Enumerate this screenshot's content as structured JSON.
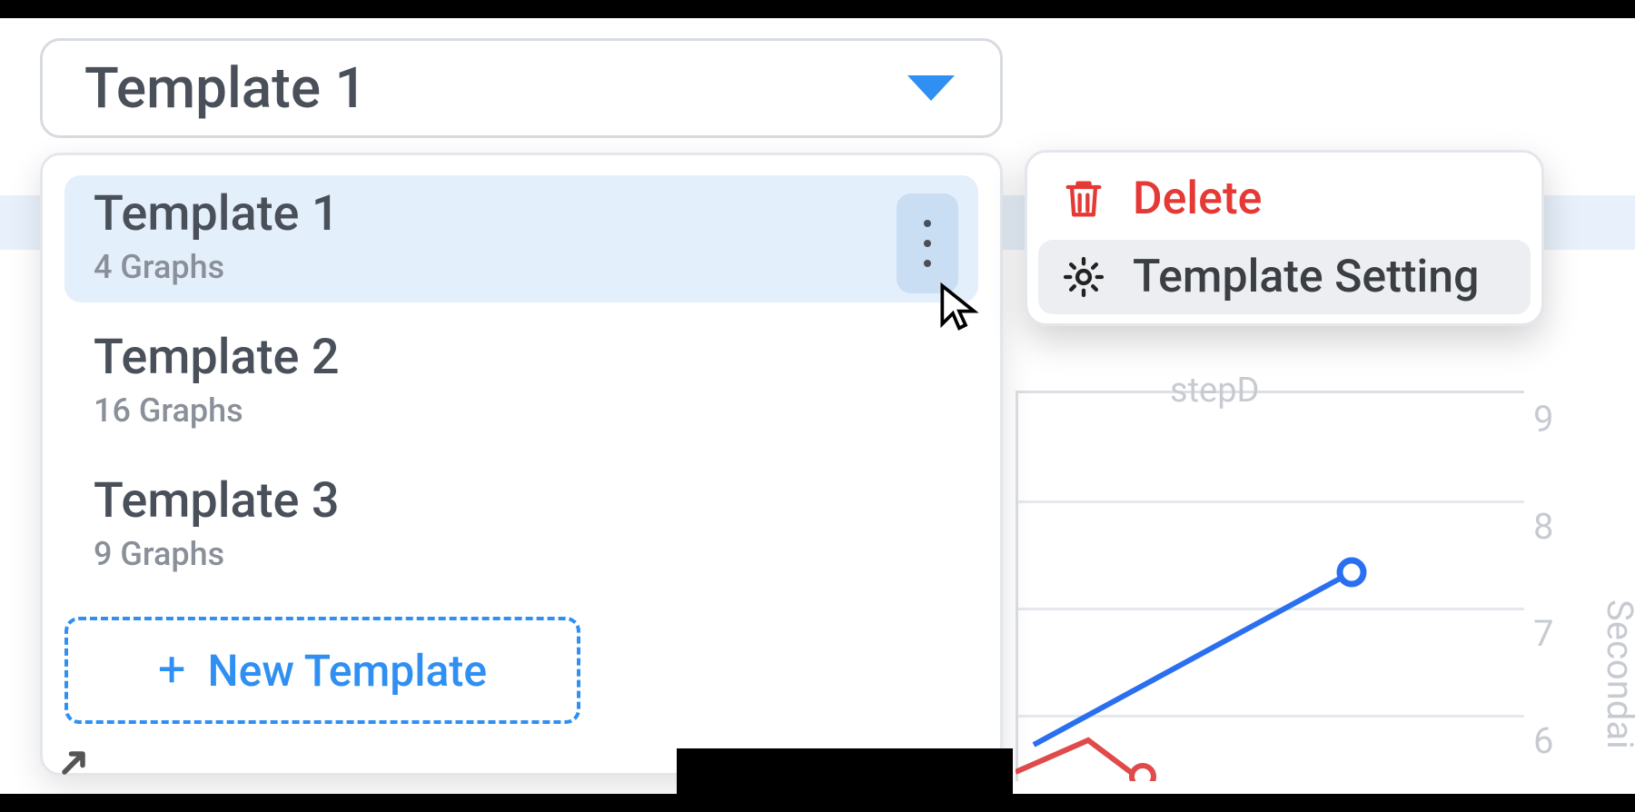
{
  "select": {
    "value": "Template 1"
  },
  "dropdown": {
    "items": [
      {
        "title": "Template 1",
        "sub": "4 Graphs",
        "selected": true
      },
      {
        "title": "Template 2",
        "sub": "16 Graphs",
        "selected": false
      },
      {
        "title": "Template 3",
        "sub": "9 Graphs",
        "selected": false
      }
    ],
    "new_template_label": "New Template"
  },
  "context_menu": {
    "delete_label": "Delete",
    "settings_label": "Template Setting"
  },
  "chart_bg": {
    "step_label": "stepD",
    "secondary_axis_label": "Secondai",
    "y2_ticks": [
      "9",
      "8",
      "7",
      "6"
    ]
  },
  "chart_data": {
    "type": "line",
    "title": "",
    "xlabel": "",
    "ylabel": "",
    "y2label": "Secondary",
    "ylim": [
      6,
      9
    ],
    "series": [
      {
        "name": "stepD (blue)",
        "color": "#2a6ff0",
        "values": [
          7.5
        ]
      },
      {
        "name": "red",
        "color": "#e04a4a",
        "values": [
          6.2,
          6.5,
          6.2
        ]
      }
    ]
  }
}
